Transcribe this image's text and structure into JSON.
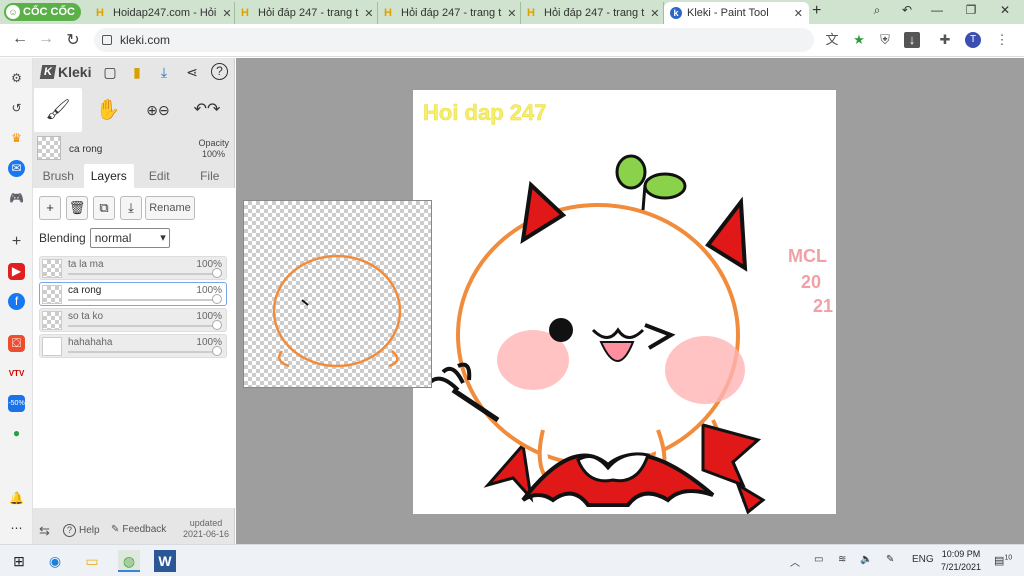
{
  "browser": {
    "logo_text": "CỐC CỐC",
    "tabs": [
      {
        "title": "Hoidap247.com - Hỏi"
      },
      {
        "title": "Hỏi đáp 247 - trang t"
      },
      {
        "title": "Hỏi đáp 247 - trang t"
      },
      {
        "title": "Hỏi đáp 247 - trang t"
      },
      {
        "title": "Kleki - Paint Tool"
      }
    ],
    "url": "kleki.com",
    "profile_initial": "T"
  },
  "kleki": {
    "app_name": "Kleki",
    "current_layer": "ca rong",
    "opacity_label": "Opacity",
    "opacity_value": "100%",
    "subtabs": [
      "Brush",
      "Layers",
      "Edit",
      "File"
    ],
    "rename_label": "Rename",
    "blending_label": "Blending",
    "blending_value": "normal",
    "layers": [
      {
        "name": "ta la ma",
        "opacity": "100%",
        "opacity_value": 1.0
      },
      {
        "name": "ca rong",
        "opacity": "100%",
        "opacity_value": 1.0
      },
      {
        "name": "so ta ko",
        "opacity": "100%",
        "opacity_value": 1.0
      },
      {
        "name": "hahahaha",
        "opacity": "100%",
        "opacity_value": 1.0
      }
    ],
    "help_label": "Help",
    "feedback_label": "Feedback",
    "updated_label": "updated",
    "updated_date": "2021-06-16"
  },
  "canvas": {
    "watermark": "Hoi dap 247",
    "signature_lines": [
      "MCL",
      "20",
      "21"
    ]
  },
  "taskbar": {
    "lang": "ENG",
    "time": "10:09 PM",
    "date": "7/21/2021",
    "notif_count": "10"
  },
  "colors": {
    "tab_bar_bg": "#cfe3cf",
    "workspace_bg": "#9e9e9e",
    "accent_blue": "#7aa6e8",
    "devil_red": "#e01818",
    "outline_orange": "#f08c3c",
    "blush_pink": "#ffb4b4",
    "sprout_green": "#8ad24a"
  }
}
